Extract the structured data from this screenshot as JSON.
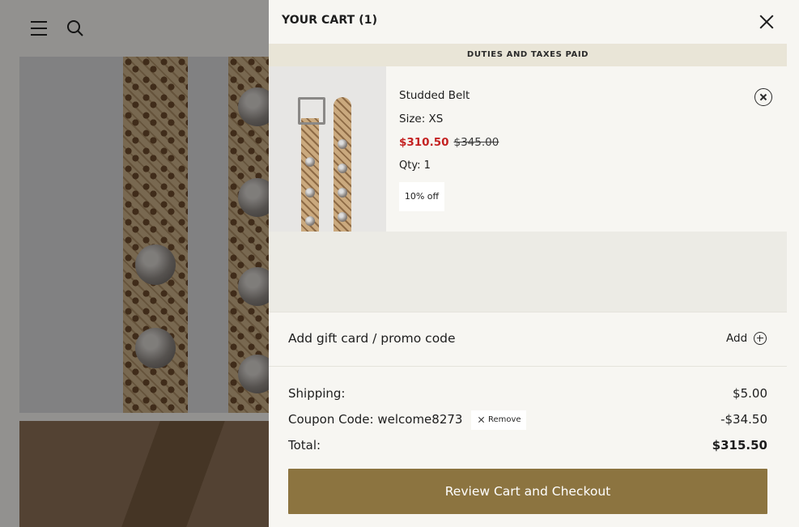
{
  "cart": {
    "title": "YOUR CART (1)",
    "duties_banner": "DUTIES AND TAXES PAID",
    "items": [
      {
        "name": "Studded Belt",
        "size": "Size: XS",
        "sale_price": "$310.50",
        "original_price": "$345.00",
        "qty": "Qty: 1",
        "discount": "10% off"
      }
    ],
    "promo": {
      "label": "Add gift card / promo code",
      "add_label": "Add"
    },
    "summary": {
      "shipping_label": "Shipping:",
      "shipping_value": "$5.00",
      "coupon_label": "Coupon Code: welcome8273",
      "coupon_remove": "Remove",
      "coupon_value": "-$34.50",
      "total_label": "Total:",
      "total_value": "$315.50"
    },
    "checkout_label": "Review Cart and Checkout"
  },
  "colors": {
    "accent": "#8c7440",
    "sale": "#c42222",
    "banner": "#e9e5d7",
    "drawer_bg": "#f7f6f2"
  },
  "icons": [
    "menu-icon",
    "search-icon",
    "close-icon",
    "remove-item-icon",
    "plus-circle-icon",
    "x-icon"
  ]
}
